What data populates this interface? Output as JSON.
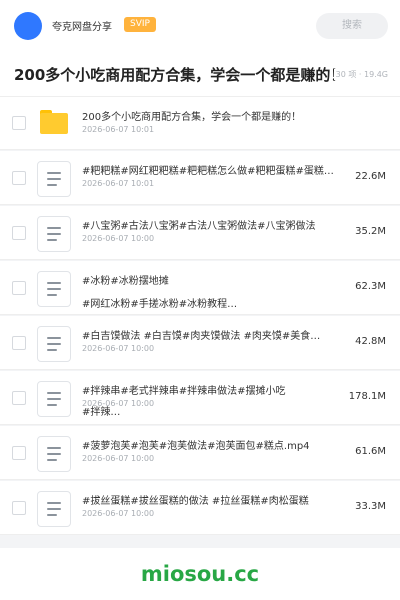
{
  "app": {
    "name": "夸克网盘分享",
    "badge": "SVIP",
    "search_placeholder": "搜索"
  },
  "folder": {
    "title": "200多个小吃商用配方合集，学会一个都是赚的！",
    "meta": "30 项 · 19.4G"
  },
  "files": [
    {
      "type": "folder",
      "name": "200多个小吃商用配方合集，学会一个都是赚的！",
      "date": "2026-06-07 10:01",
      "size": ""
    },
    {
      "type": "doc",
      "name": "#粑粑糕#网红粑粑糕#粑粑糕怎么做#粑粑蛋糕#蛋糕…",
      "date": "2026-06-07 10:01",
      "size": "22.6M"
    },
    {
      "type": "doc",
      "name": "#八宝粥#古法八宝粥#古法八宝粥做法#八宝粥做法",
      "date": "2026-06-07 10:00",
      "size": "35.2M"
    },
    {
      "type": "doc",
      "name": "#冰粉#冰粉摆地摊",
      "name2": "#网红冰粉#手搓冰粉#冰粉教程…",
      "date": "",
      "size": "62.3M"
    },
    {
      "type": "doc",
      "name": "#白吉馍做法 #白吉馍#肉夹馍做法 #肉夹馍#美食…",
      "date": "2026-06-07 10:00",
      "size": "42.8M"
    },
    {
      "type": "doc",
      "name": "#拌辣串#老式拌辣串#拌辣串做法#摆摊小吃",
      "name2": "#拌辣…",
      "date": "2026-06-07 10:00",
      "size": "178.1M"
    },
    {
      "type": "doc",
      "name": "#菠萝泡芙#泡芙#泡芙做法#泡芙面包#糕点.mp4",
      "date": "2026-06-07 10:00",
      "size": "61.6M"
    },
    {
      "type": "doc",
      "name": "#拔丝蛋糕#拔丝蛋糕的做法 #拉丝蛋糕#肉松蛋糕",
      "date": "2026-06-07 10:00",
      "size": "33.3M"
    }
  ],
  "footer": {
    "brand": "miosou.cc"
  },
  "colors": {
    "accent": "#2f78ff",
    "svip": "#ffb33d",
    "folder": "#ffcb2f",
    "brand": "#28a745"
  }
}
